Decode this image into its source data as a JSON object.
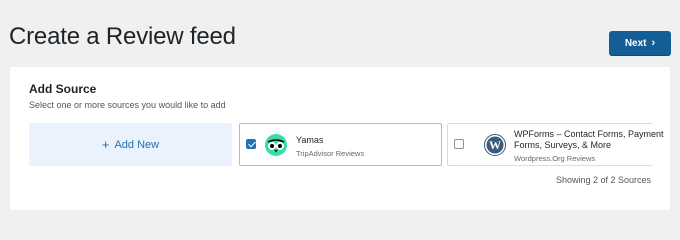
{
  "header": {
    "title": "Create a Review feed",
    "next_label": "Next",
    "next_icon": "chevron-right-icon"
  },
  "colors": {
    "primary": "#135e96",
    "add_new_bg": "#e9f2fd",
    "link": "#2271b1",
    "checkbox_checked": "#2271b1",
    "tripadvisor_green": "#34e0a1"
  },
  "panel": {
    "title": "Add Source",
    "subtitle": "Select one or more sources you would like to add",
    "add_new_label": "Add New",
    "add_new_icon": "plus-icon",
    "sources": [
      {
        "name": "Yamas",
        "type": "TripAdvisor Reviews",
        "checked": true,
        "icon": "tripadvisor-owl-icon"
      },
      {
        "name": "WPForms – Contact Forms, Payment Forms, Surveys, & More",
        "type": "Wordpress.Org Reviews",
        "checked": false,
        "icon": "wordpress-icon"
      }
    ],
    "showing_text": "Showing 2 of 2 Sources"
  }
}
